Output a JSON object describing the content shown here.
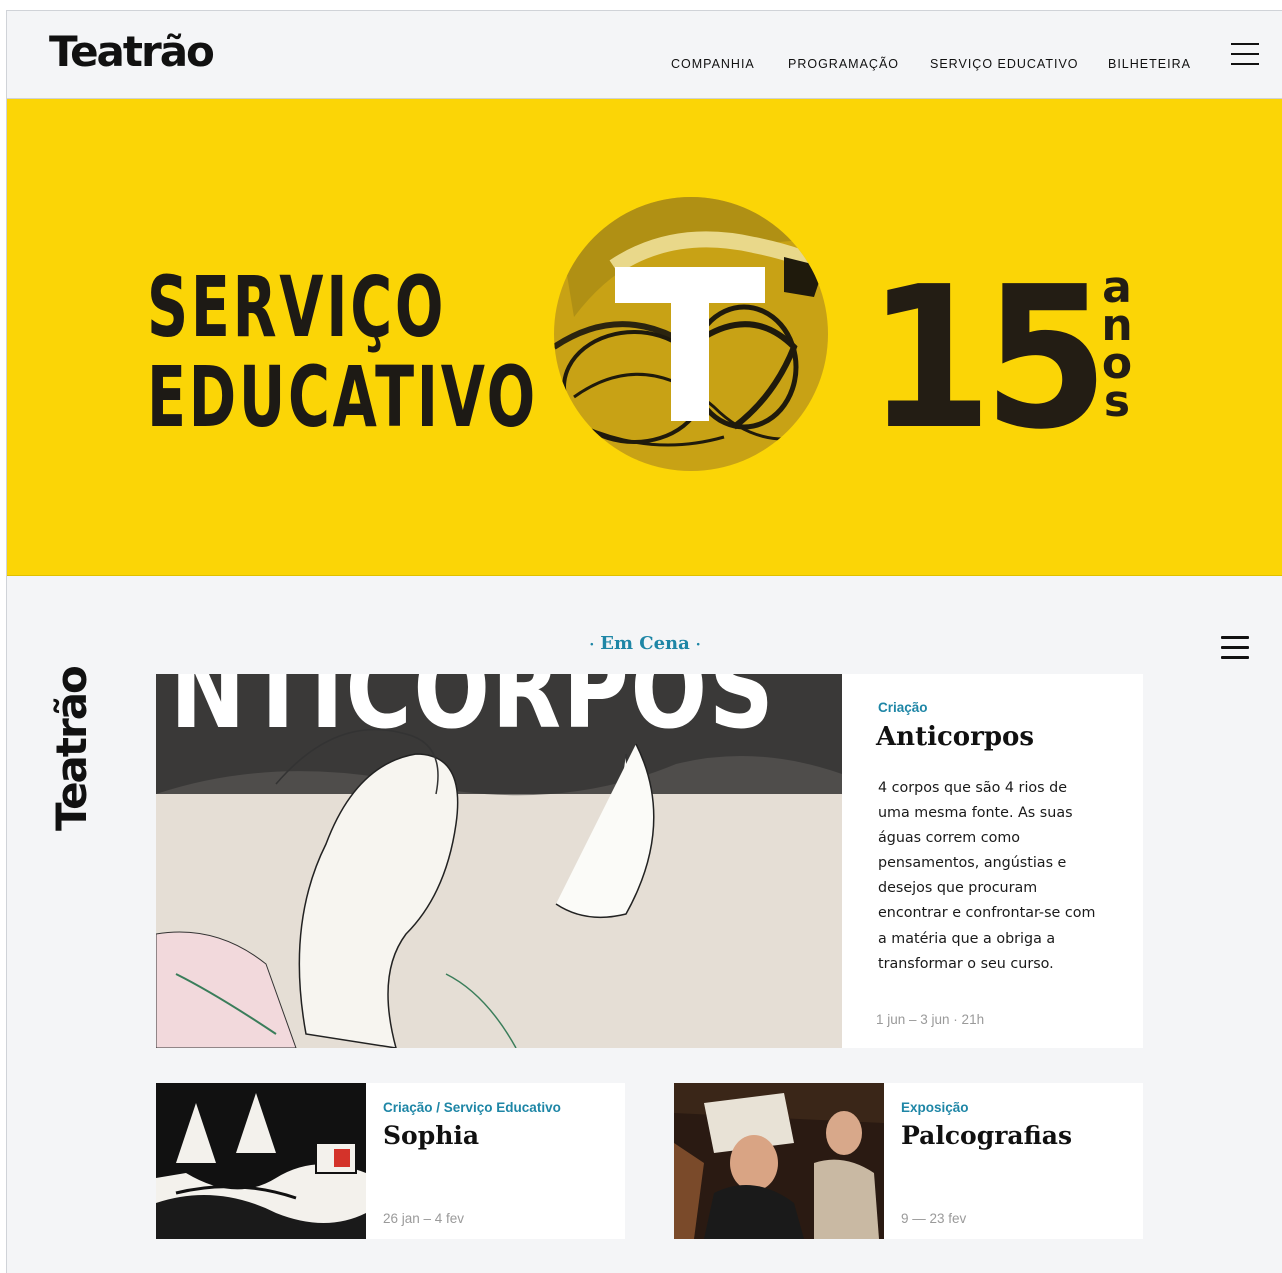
{
  "header": {
    "logo": "Teatrão",
    "nav": [
      "COMPANHIA",
      "PROGRAMAÇÃO",
      "SERVIÇO EDUCATIVO",
      "BILHETEIRA"
    ]
  },
  "hero": {
    "line1": "SERVIÇO",
    "line2": "EDUCATIVO",
    "number": "15",
    "anos": [
      "a",
      "n",
      "o",
      "s"
    ],
    "background": "#fbd506"
  },
  "side_logo": "Teatrão",
  "section": {
    "title": "Em Cena"
  },
  "featured": {
    "category": "Criação",
    "title": "Anticorpos",
    "image_text": "NTICORPOS",
    "description": [
      "4 corpos que são 4 rios de",
      "uma mesma fonte. As suas",
      "águas correm como",
      "pensamentos, angústias e",
      "desejos que procuram",
      "encontrar e confrontar-se com",
      "a matéria que a obriga a",
      "transformar o seu curso."
    ],
    "dates": "1 jun – 3 jun · 21h"
  },
  "cards": [
    {
      "category": "Criação / Serviço Educativo",
      "title": "Sophia",
      "dates": "26 jan – 4 fev"
    },
    {
      "category": "Exposição",
      "title": "Palcografias",
      "dates": "9 — 23 fev"
    }
  ],
  "colors": {
    "accent": "#1e86a6",
    "yellow": "#fbd506",
    "ink": "#111111"
  }
}
